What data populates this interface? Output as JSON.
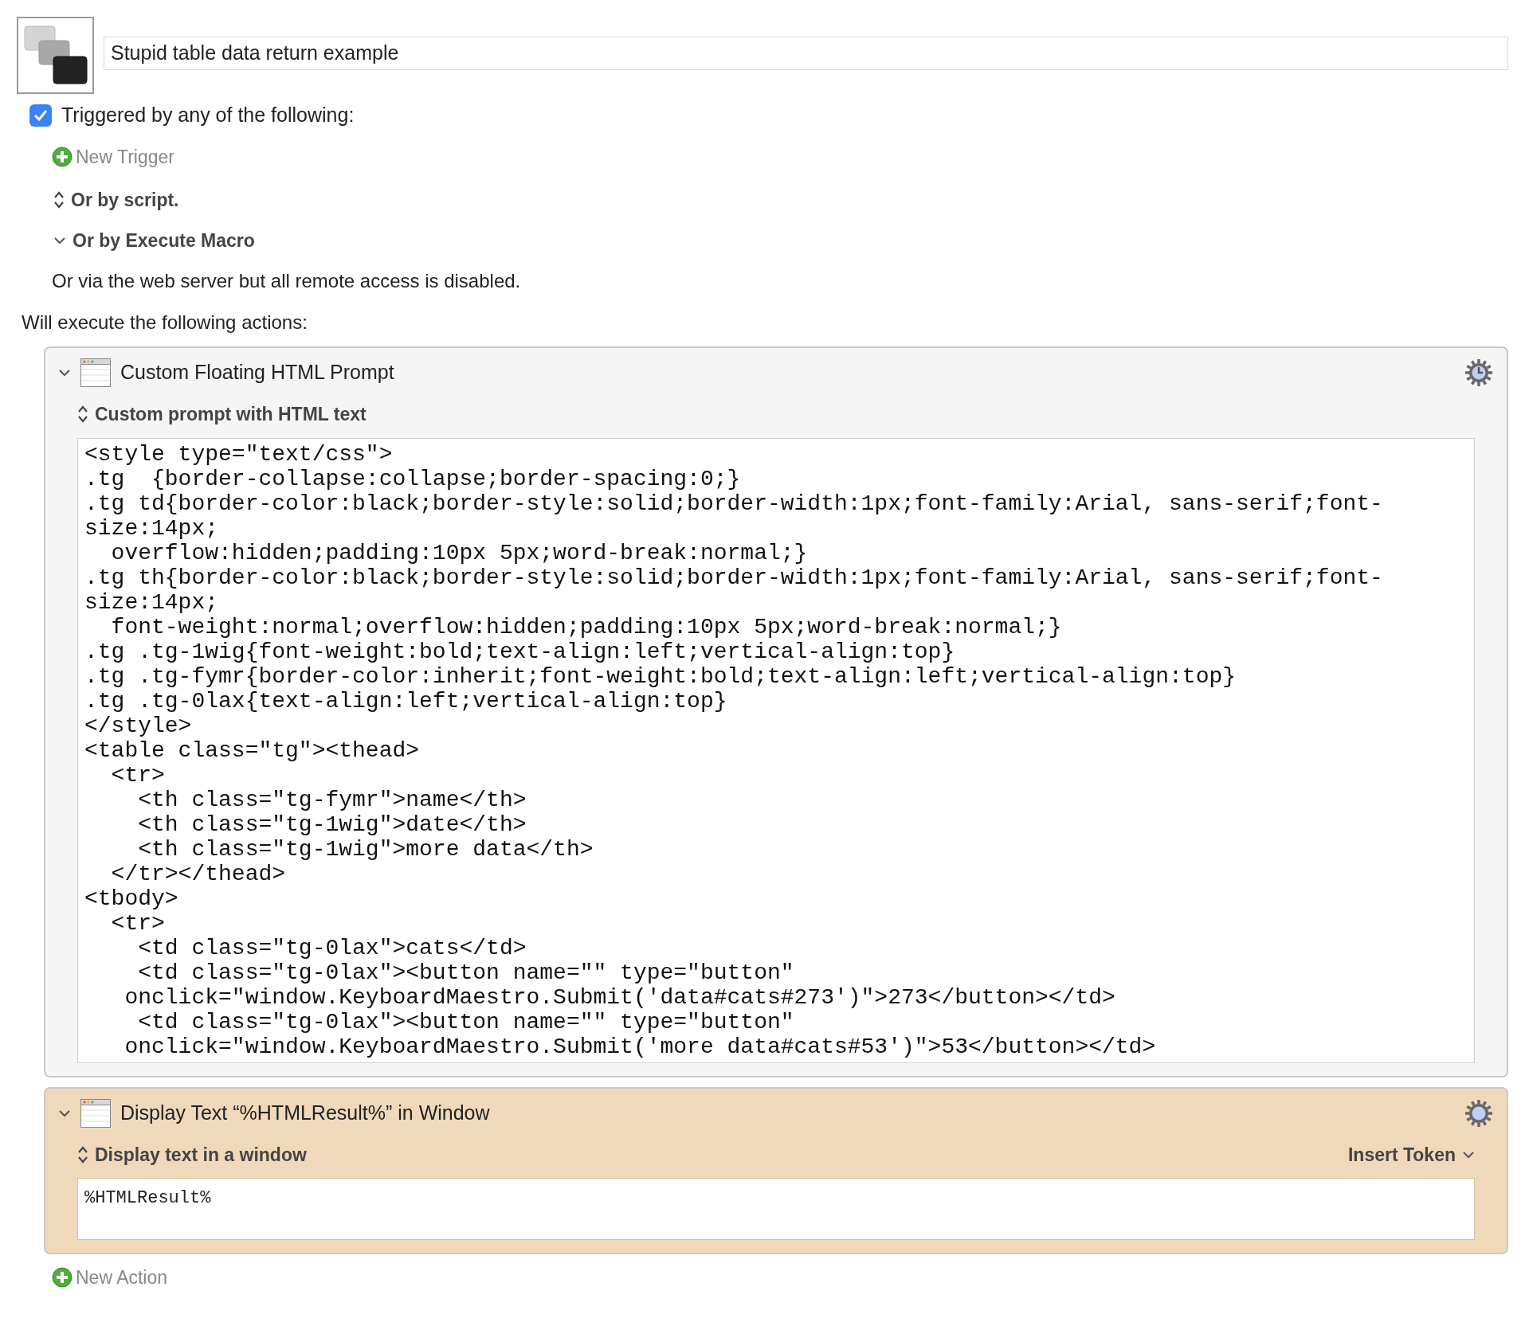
{
  "macro": {
    "name": "Stupid table data return example"
  },
  "triggers": {
    "enabled": true,
    "label": "Triggered by any of the following:",
    "new_trigger": "New Trigger",
    "sections": [
      {
        "label": "Or by script.",
        "expanded": false
      },
      {
        "label": "Or by Execute Macro",
        "expanded": true
      }
    ],
    "note": "Or via the web server but all remote access is disabled."
  },
  "actions_heading": "Will execute the following actions:",
  "actions": [
    {
      "kind": "html_prompt",
      "title": "Custom Floating HTML Prompt",
      "expanded": true,
      "color": "#f5f5f5",
      "subtitle": "Custom prompt with HTML text",
      "code_lines": [
        "<style type=\"text/css\">",
        ".tg  {border-collapse:collapse;border-spacing:0;}",
        ".tg td{border-color:black;border-style:solid;border-width:1px;font-family:Arial, sans-serif;font-",
        "size:14px;",
        "  overflow:hidden;padding:10px 5px;word-break:normal;}",
        ".tg th{border-color:black;border-style:solid;border-width:1px;font-family:Arial, sans-serif;font-",
        "size:14px;",
        "  font-weight:normal;overflow:hidden;padding:10px 5px;word-break:normal;}",
        ".tg .tg-1wig{font-weight:bold;text-align:left;vertical-align:top}",
        ".tg .tg-fymr{border-color:inherit;font-weight:bold;text-align:left;vertical-align:top}",
        ".tg .tg-0lax{text-align:left;vertical-align:top}",
        "</style>",
        "<table class=\"tg\"><thead>",
        "  <tr>",
        "    <th class=\"tg-fymr\">name</th>",
        "    <th class=\"tg-1wig\">date</th>",
        "    <th class=\"tg-1wig\">more data</th>",
        "  </tr></thead>",
        "<tbody>",
        "  <tr>",
        "    <td class=\"tg-0lax\">cats</td>",
        "    <td class=\"tg-0lax\"><button name=\"\" type=\"button\"",
        "   onclick=\"window.KeyboardMaestro.Submit('data#cats#273')\">273</button></td>",
        "    <td class=\"tg-0lax\"><button name=\"\" type=\"button\"",
        "   onclick=\"window.KeyboardMaestro.Submit('more data#cats#53')\">53</button></td>"
      ]
    },
    {
      "kind": "display_text",
      "title": "Display Text “%HTMLResult%” in Window",
      "expanded": true,
      "color": "#f0d9bb",
      "subtitle": "Display text in a window",
      "insert_token": "Insert Token",
      "text": "%HTMLResult%"
    }
  ],
  "new_action": "New Action"
}
